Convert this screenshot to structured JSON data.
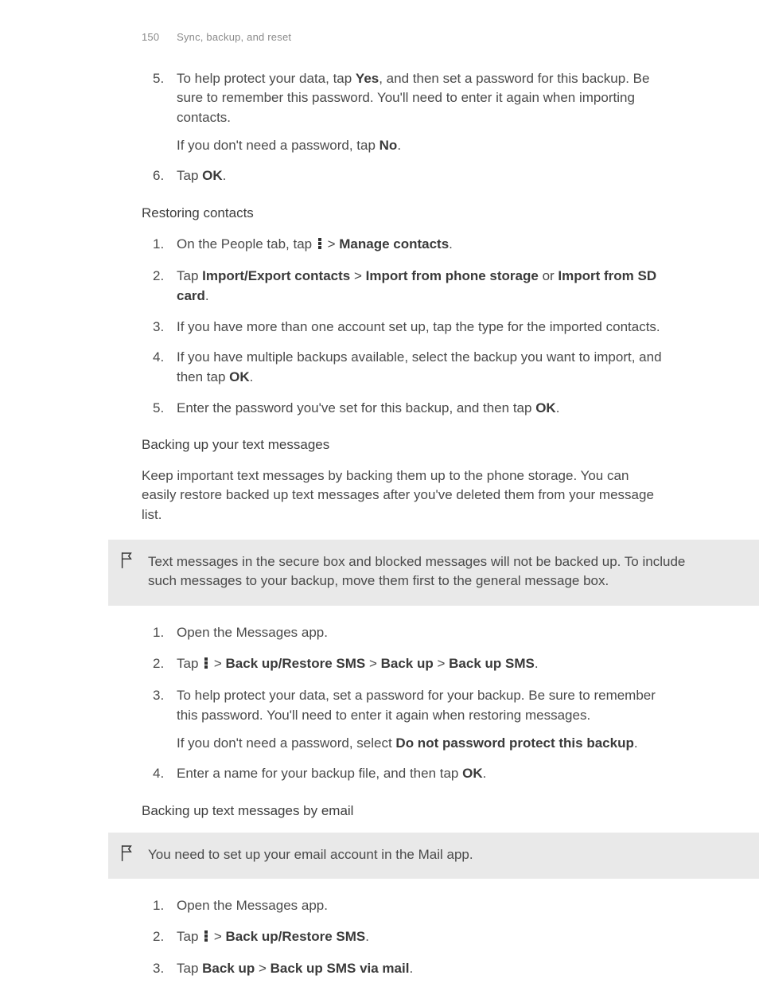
{
  "header": {
    "page_number": "150",
    "section_title": "Sync, backup, and reset"
  },
  "protect_steps": {
    "n5": "5.",
    "n6": "6.",
    "s5a_1": "To help protect your data, tap ",
    "s5a_yes": "Yes",
    "s5a_2": ", and then set a password for this backup. Be sure to remember this password. You'll need to enter it again when importing contacts.",
    "s5b_1": "If you don't need a password, tap ",
    "s5b_no": "No",
    "s5b_2": ".",
    "s6_1": "Tap ",
    "s6_ok": "OK",
    "s6_2": "."
  },
  "restoring": {
    "heading": "Restoring contacts",
    "n1": "1.",
    "n2": "2.",
    "n3": "3.",
    "n4": "4.",
    "n5": "5.",
    "s1_1": "On the People tab, tap ",
    "s1_gt": " > ",
    "s1_mc": "Manage contacts",
    "s1_2": ".",
    "s2_1": "Tap ",
    "s2_ie": "Import/Export contacts",
    "s2_gt1": " > ",
    "s2_ips": "Import from phone storage",
    "s2_or": " or ",
    "s2_isd": "Import from SD card",
    "s2_2": ".",
    "s3": "If you have more than one account set up, tap the type for the imported contacts.",
    "s4_1": "If you have multiple backups available, select the backup you want to import, and then tap ",
    "s4_ok": "OK",
    "s4_2": ".",
    "s5_1": "Enter the password you've set for this backup, and then tap ",
    "s5_ok": "OK",
    "s5_2": "."
  },
  "backup_sms": {
    "heading": "Backing up your text messages",
    "intro": "Keep important text messages by backing them up to the phone storage. You can easily restore backed up text messages after you've deleted them from your message list.",
    "callout": "Text messages in the secure box and blocked messages will not be backed up. To include such messages to your backup, move them first to the general message box.",
    "n1": "1.",
    "n2": "2.",
    "n3": "3.",
    "n4": "4.",
    "s1": "Open the Messages app.",
    "s2_1": "Tap ",
    "s2_gt1": " > ",
    "s2_b1": "Back up/Restore SMS",
    "s2_gt2": " > ",
    "s2_b2": "Back up",
    "s2_gt3": " > ",
    "s2_b3": "Back up SMS",
    "s2_2": ".",
    "s3a": "To help protect your data, set a password for your backup. Be sure to remember this password. You'll need to enter it again when restoring messages.",
    "s3b_1": "If you don't need a password, select ",
    "s3b_b": "Do not password protect this backup",
    "s3b_2": ".",
    "s4_1": "Enter a name for your backup file, and then tap ",
    "s4_ok": "OK",
    "s4_2": "."
  },
  "backup_email": {
    "heading": "Backing up text messages by email",
    "callout": "You need to set up your email account in the Mail app.",
    "n1": "1.",
    "n2": "2.",
    "n3": "3.",
    "s1": "Open the Messages app.",
    "s2_1": "Tap ",
    "s2_gt": " > ",
    "s2_b": "Back up/Restore SMS",
    "s2_2": ".",
    "s3_1": "Tap ",
    "s3_b1": "Back up",
    "s3_gt": " > ",
    "s3_b2": "Back up SMS via mail",
    "s3_2": "."
  }
}
